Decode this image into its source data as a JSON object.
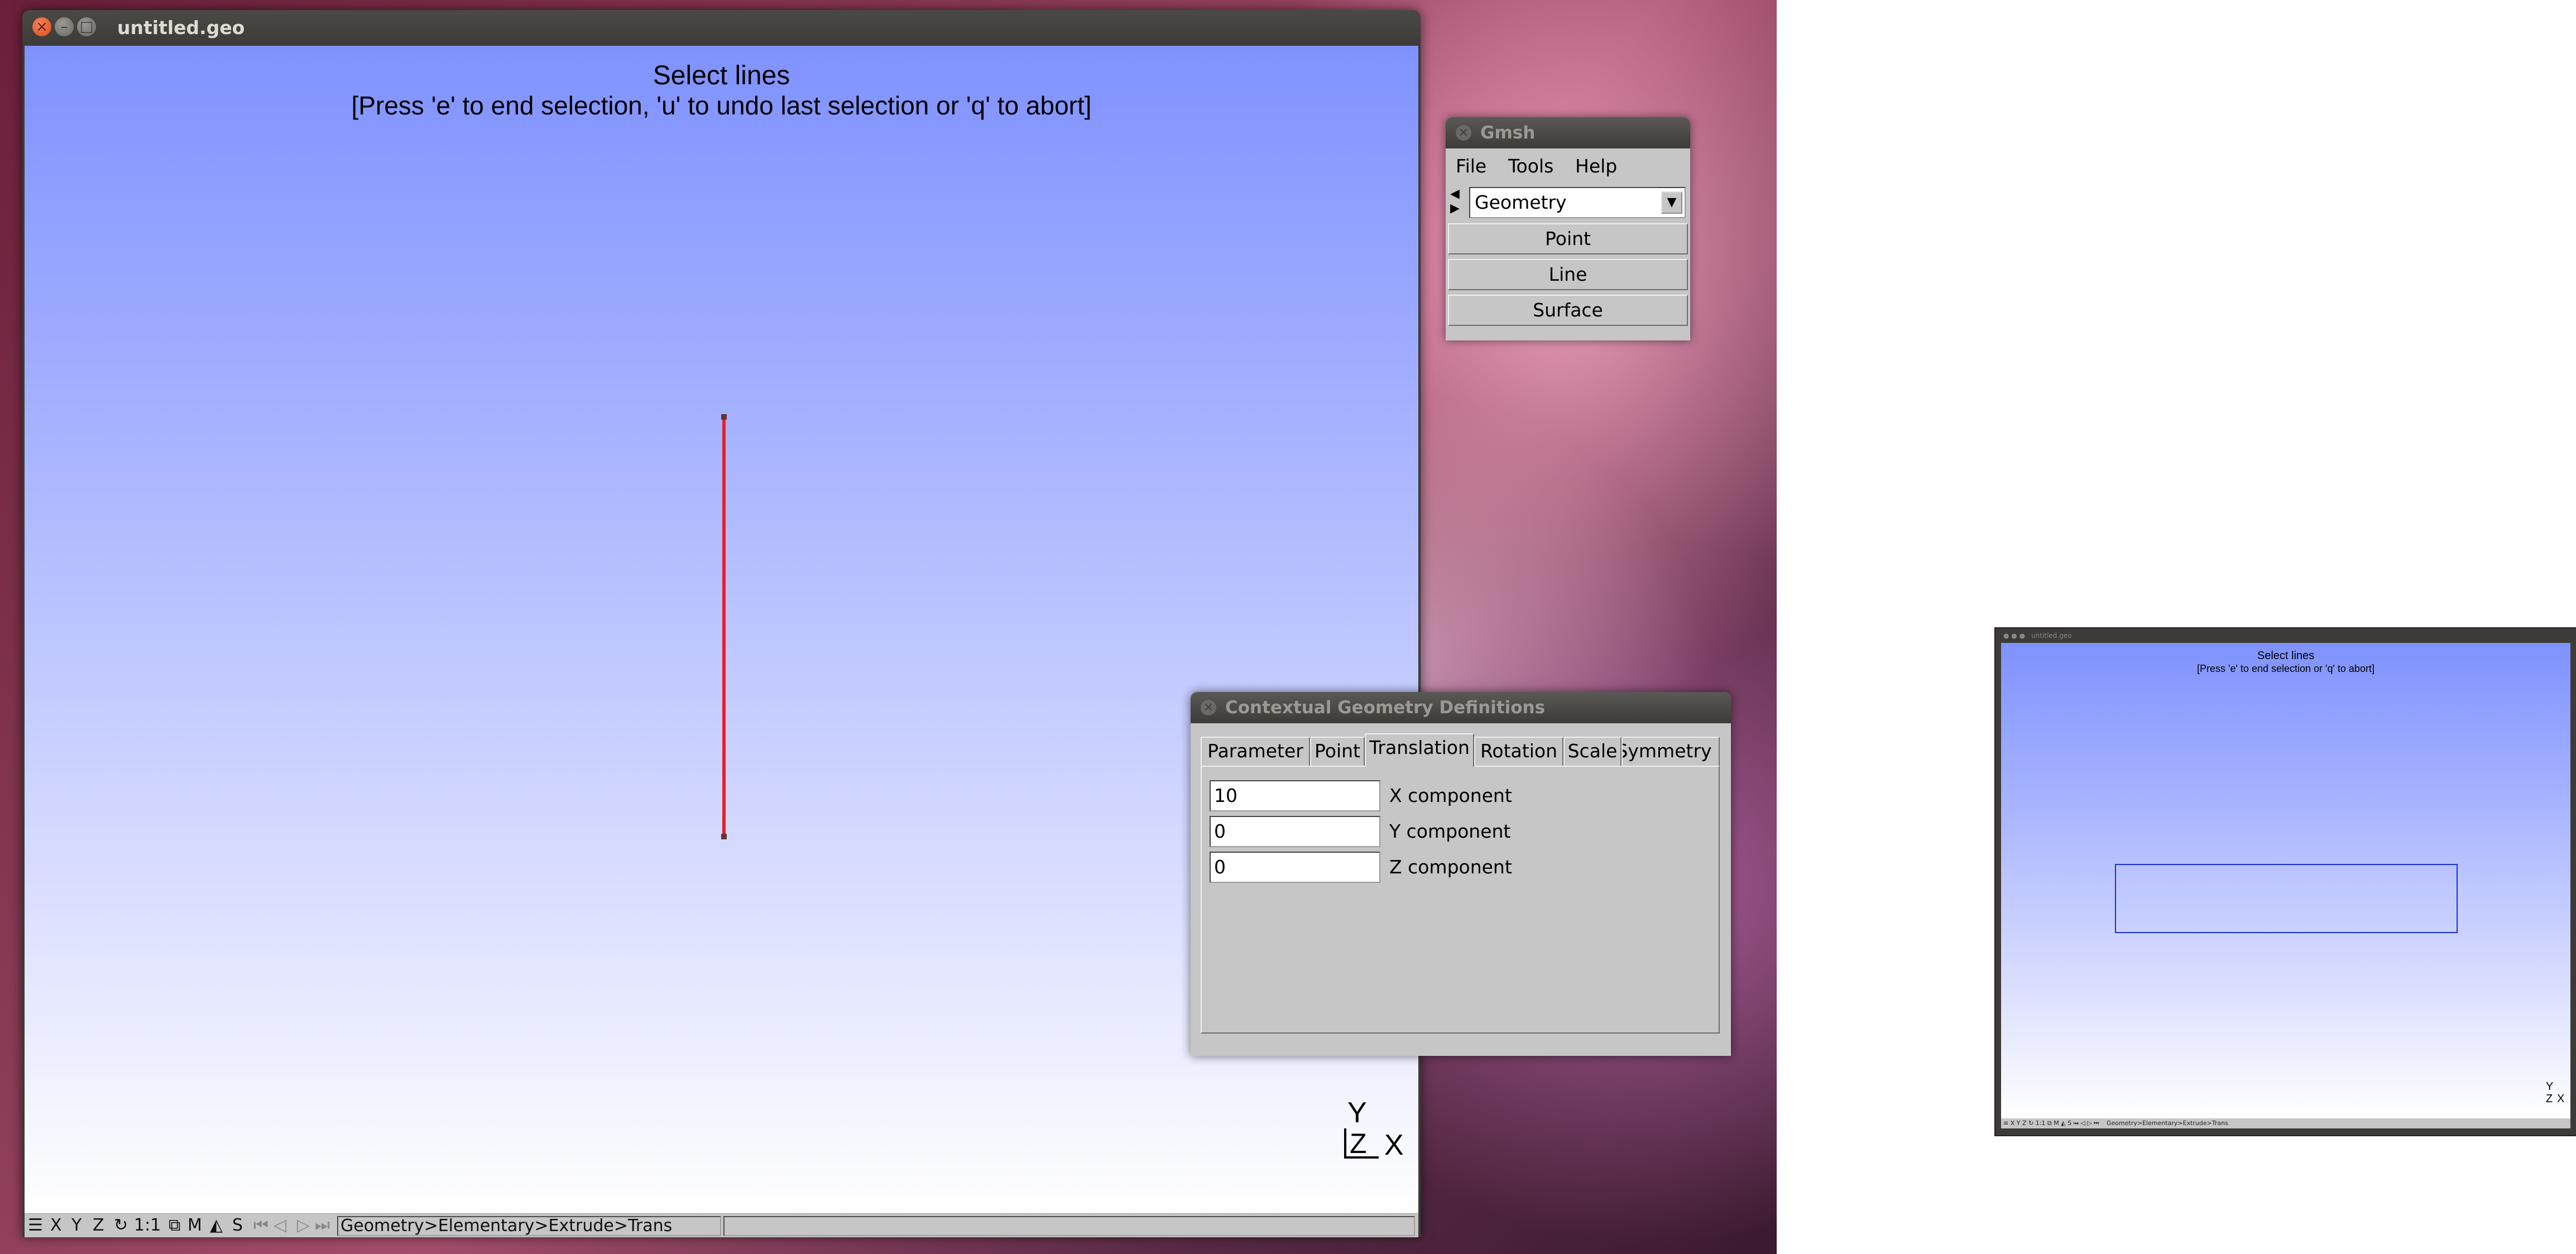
{
  "main_window": {
    "title": "untitled.geo",
    "prompt_line1": "Select lines",
    "prompt_line2": "[Press 'e' to end selection, 'u' to undo last selection or 'q' to abort]",
    "axes": {
      "y": "Y",
      "z": "Z",
      "x": "X"
    },
    "status_bar": {
      "items": [
        "X",
        "Y",
        "Z",
        "1:1",
        "M",
        "S"
      ],
      "path": "Geometry>Elementary>Extrude>Trans"
    }
  },
  "gmsh_window": {
    "title": "Gmsh",
    "menu": [
      "File",
      "Tools",
      "Help"
    ],
    "module": "Geometry",
    "buttons": [
      "Point",
      "Line",
      "Surface"
    ]
  },
  "ctx_window": {
    "title": "Contextual Geometry Definitions",
    "tabs": [
      "Parameter",
      "Point",
      "Translation",
      "Rotation",
      "Scale",
      "Symmetry"
    ],
    "active_tab": "Translation",
    "fields": [
      {
        "value": "10",
        "label": "X component"
      },
      {
        "value": "0",
        "label": "Y component"
      },
      {
        "value": "0",
        "label": "Z component"
      }
    ]
  },
  "thumbnail": {
    "title": "untitled.geo",
    "prompt_line1": "Select lines",
    "prompt_line2": "[Press 'e' to end selection or 'q' to abort]",
    "axes": {
      "y": "Y",
      "z": "Z",
      "x": "X"
    },
    "status_path": "Geometry>Elementary>Extrude>Trans"
  },
  "colors": {
    "selected_line": "#e8202a",
    "selection_box": "#1a2fd6",
    "canvas_top": "#7f92ff",
    "canvas_bottom": "#ffffff"
  }
}
